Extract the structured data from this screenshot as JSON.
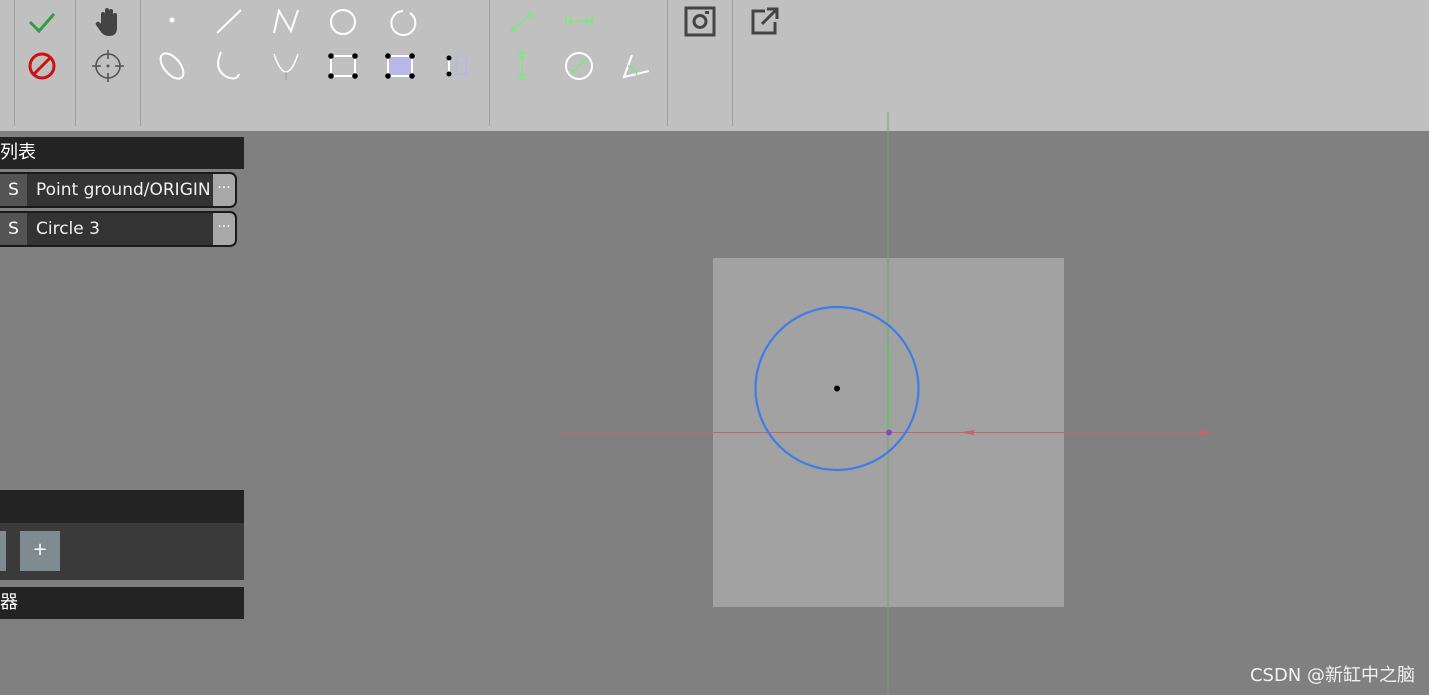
{
  "toolbar": {
    "groups": [
      {
        "name": "confirm",
        "tools": [
          "check-icon",
          "cancel-icon"
        ]
      },
      {
        "name": "view",
        "tools": [
          "pan-hand-icon",
          "center-target-icon"
        ]
      },
      {
        "name": "draw",
        "tools": [
          "point-icon",
          "line-icon",
          "polyline-icon",
          "circle-icon",
          "arc-icon",
          "ellipse-icon",
          "elliptic-arc-icon",
          "parabola-icon",
          "rectangle-icon",
          "filled-rectangle-icon",
          "rectangle-partial-icon"
        ]
      },
      {
        "name": "constraints",
        "tools": [
          "length-constraint-icon",
          "horizontal-distance-icon",
          "vertical-distance-icon",
          "diameter-constraint-icon",
          "angle-constraint-icon"
        ]
      },
      {
        "name": "capture",
        "tools": [
          "screenshot-icon"
        ]
      },
      {
        "name": "export",
        "tools": [
          "external-link-icon"
        ]
      }
    ],
    "colors": {
      "confirm": "#2e9e3e",
      "cancel": "#cc1111",
      "constraint": "#7de87d",
      "tool": "#ffffff"
    }
  },
  "feature_list": {
    "title": "列表",
    "items": [
      {
        "s_label": "S",
        "name": "Point ground/ORIGIN",
        "more": "···"
      },
      {
        "s_label": "S",
        "name": "Circle 3",
        "more": "···"
      }
    ]
  },
  "panel_middle": {
    "title": ""
  },
  "parameters": {
    "title": "",
    "add_label": "+"
  },
  "panel_bottom": {
    "title": "器"
  },
  "scene": {
    "plane_color": "#a2a2a2",
    "circle_color": "#3b7dea",
    "x_axis_color": "#c86464",
    "y_axis_color": "#64b064",
    "origin_color": "#8844cc",
    "center_color": "#000000"
  },
  "watermark": "CSDN @新缸中之脑"
}
